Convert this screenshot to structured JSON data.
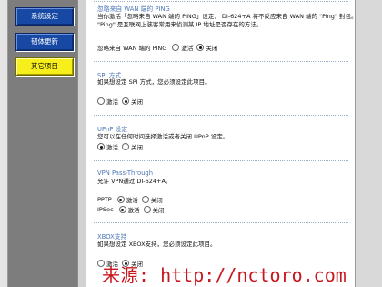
{
  "sidebar": {
    "buttons": [
      {
        "label": "系统设定",
        "active": false
      },
      {
        "label": "韧体更新",
        "active": false
      },
      {
        "label": "其它项目",
        "active": true
      }
    ]
  },
  "sections": {
    "ping": {
      "title": "忽略来自 WAN 端的 PING",
      "desc_line1": "当你激活「忽略来自 WAN 端的 PING」设定， DI-624+A 将不反应来自 WAN 端的 \"Ping\" 封包。",
      "desc_line2": "\"Ping\" 是互联网上骇客常用来侦测某 IP 地址是否存在的方法。",
      "field_label": "忽略来自 WAN 端的 PING",
      "opt_enable": "激活",
      "opt_disable": "关闭",
      "selected": "关闭"
    },
    "spi": {
      "title": "SPI 方式",
      "desc": "如果想设定 SPI 方式，您必须设定此项目。",
      "opt_enable": "激活",
      "opt_disable": "关闭",
      "selected": "关闭"
    },
    "upnp": {
      "title": "UPnP 设定",
      "desc": "您可以在任何时间选择激活或者关闭 UPnP 设定。",
      "opt_enable": "激活",
      "opt_disable": "关闭",
      "selected": "激活"
    },
    "vpn": {
      "title": "VPN Pass-Through",
      "desc": "允许 VPN通过 DI-624+A。",
      "pptp_label": "PPTP",
      "ipsec_label": "IPSec",
      "opt_enable": "激活",
      "opt_disable": "关闭",
      "pptp_selected": "激活",
      "ipsec_selected": "激活"
    },
    "xbox": {
      "title": "XBOX支持",
      "desc": "如果想设定 XBOX支持，您必须设定此项目。",
      "opt_enable": "激活",
      "opt_disable": "关闭",
      "selected": "激活"
    }
  },
  "watermark": "来源: http://nctoro.com",
  "colors": {
    "sidebar_bg": "#7d7d7d",
    "button_blue": "#1648a4",
    "button_active": "#f6ef1c",
    "section_title": "#4f78b8",
    "watermark": "#c9171f"
  }
}
